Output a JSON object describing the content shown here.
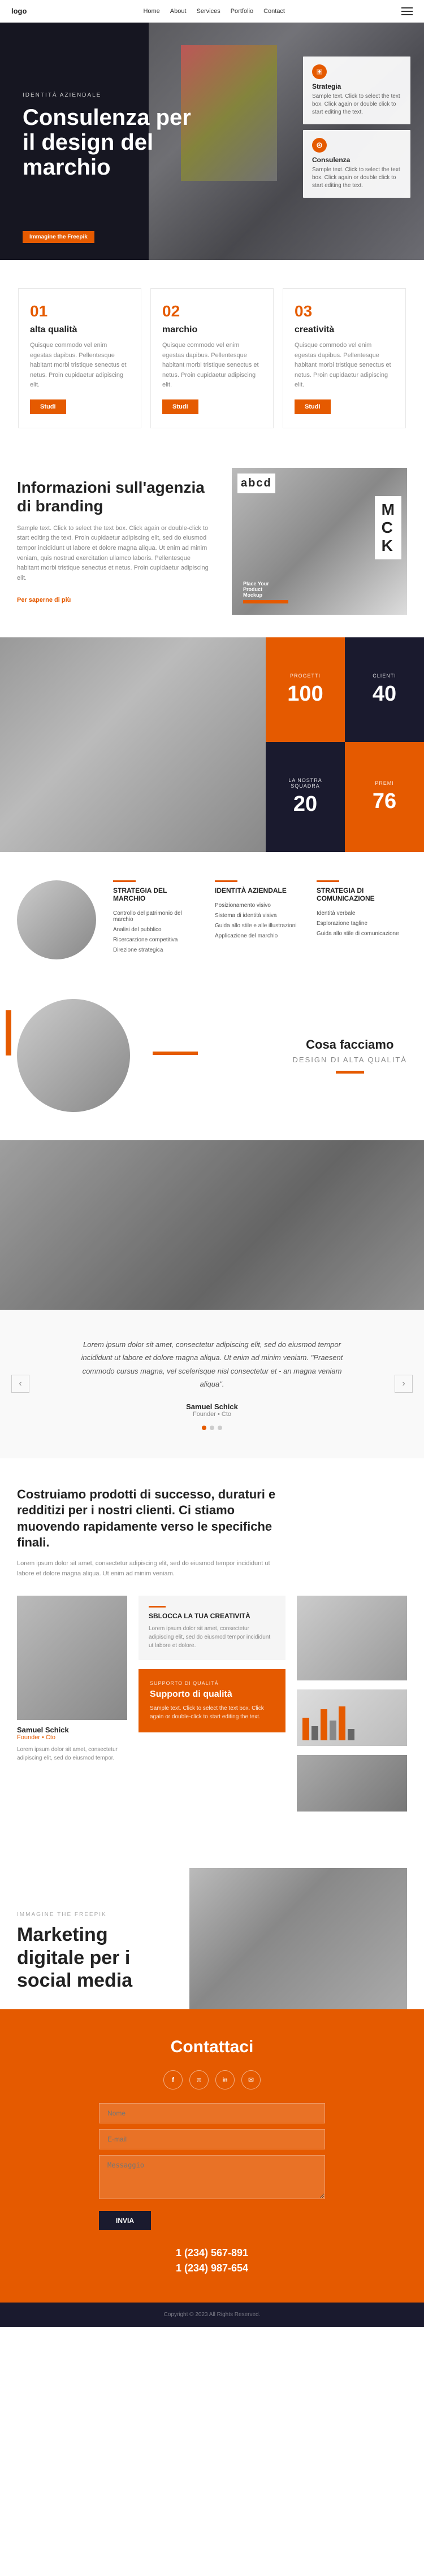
{
  "nav": {
    "logo": "logo",
    "links": [
      "Home",
      "About",
      "Services",
      "Portfolio",
      "Contact"
    ],
    "menu_icon": "☰"
  },
  "hero": {
    "label": "IDENTITÀ AZIENDALE",
    "title": "Consulenza per il design del marchio",
    "badge_text": "Immagine the Freepik",
    "card1": {
      "title": "Strategia",
      "text": "Sample text. Click to select the text box. Click again or double click to start editing the text."
    },
    "card2": {
      "title": "Consulenza",
      "text": "Sample text. Click to select the text box. Click again or double click to start editing the text."
    }
  },
  "features": [
    {
      "num": "01",
      "title": "alta qualità",
      "text": "Quisque commodo vel enim egestas dapibus. Pellentesque habitant morbi tristique senectus et netus. Proin cupidaetur adipiscing elit.",
      "btn": "Studi"
    },
    {
      "num": "02",
      "title": "marchio",
      "text": "Quisque commodo vel enim egestas dapibus. Pellentesque habitant morbi tristique senectus et netus. Proin cupidaetur adipiscing elit.",
      "btn": "Studi"
    },
    {
      "num": "03",
      "title": "creatività",
      "text": "Quisque commodo vel enim egestas dapibus. Pellentesque habitant morbi tristique senectus et netus. Proin cupidaetur adipiscing elit.",
      "btn": "Studi"
    }
  ],
  "branding": {
    "title": "Informazioni sull'agenzia di branding",
    "text": "Sample text. Click to select the text box. Click again or double-click to start editing the text. Proin cupidaetur adipiscing elit, sed do eiusmod tempor incididunt ut labore et dolore magna aliqua. Ut enim ad minim veniam, quis nostrud exercitation ullamco laboris. Pellentesque habitant morbi tristique senectus et netus. Proin cupidaetur adipiscing elit.",
    "link": "Per saperne di più"
  },
  "stats": [
    {
      "label": "PROGETTI",
      "num": "100"
    },
    {
      "label": "CLIENTI",
      "num": "40"
    },
    {
      "label": "LA NOSTRA SQUADRA",
      "num": "20"
    },
    {
      "label": "PREMI",
      "num": "76"
    }
  ],
  "services": [
    {
      "title": "STRATEGIA DEL MARCHIO",
      "items": [
        "Controllo del patrimonio del marchio",
        "Analisi del pubblico",
        "Ricercarzione competitiva",
        "Direzione strategica"
      ]
    },
    {
      "title": "IDENTITÀ AZIENDALE",
      "items": [
        "Posizionamento visivo",
        "Sistema di identità visiva",
        "Guida allo stile e alle illustrazioni",
        "Applicazione del marchio"
      ]
    },
    {
      "title": "STRATEGIA DI COMUNICAZIONE",
      "items": [
        "Identità verbale",
        "Esplorazione tagline",
        "Guida allo stile di comunicazione"
      ]
    }
  ],
  "what_we_do": {
    "subtitle": "Cosa facciamo",
    "title": "DESIGN DI ALTA QUALITÀ"
  },
  "testimonial": {
    "text": "Lorem ipsum dolor sit amet, consectetur adipiscing elit, sed do eiusmod tempor incididunt ut labore et dolore magna aliqua. Ut enim ad minim veniam. \"Praesent commodo cursus magna, vel scelerisque nisl consectetur et - an magna veniam aliqua\".",
    "author": "Samuel Schick",
    "role": "Founder • Cto",
    "dots": [
      true,
      false,
      false
    ]
  },
  "build": {
    "title": "Costruiamo prodotti di successo, duraturi e redditizi per i nostri clienti. Ci stiamo muovendo rapidamente verso le specifiche finali.",
    "text": "Lorem ipsum dolor sit amet, consectetur adipiscing elit, sed do eiusmod tempor incididunt ut labore et dolore magna aliqua. Ut enim ad minim veniam.",
    "person": {
      "name": "Samuel Schick",
      "role": "Founder • Cto",
      "desc": "Lorem ipsum dolor sit amet, consectetur adipiscing elit, sed do eiusmod tempor."
    },
    "section_label": "SBLOCCA LA TUA CREATIVITÀ",
    "section_text": "Lorem ipsum dolor sit amet, consectetur adipiscing elit, sed do eiusmod tempor incididunt ut labore et dolore.",
    "support": {
      "label": "SUPPORTO DI QUALITÀ",
      "title": "Supporto di qualità",
      "text": "Sample text. Click to select the text box. Click again or double-click to start editing the text."
    }
  },
  "marketing": {
    "label": "Immagine the Freepik",
    "title": "Marketing digitale per i social media"
  },
  "contact": {
    "title": "Contattaci",
    "social": [
      "f",
      "π",
      "in",
      "✉"
    ],
    "phone1": "1 (234) 567-891",
    "phone2": "1 (234) 987-654",
    "placeholders": {
      "name": "Nome",
      "email": "E-mail",
      "message": "Messaggio"
    },
    "submit": "INVIA"
  },
  "footer": {
    "text": "Copyright © 2023 All Rights Reserved."
  }
}
